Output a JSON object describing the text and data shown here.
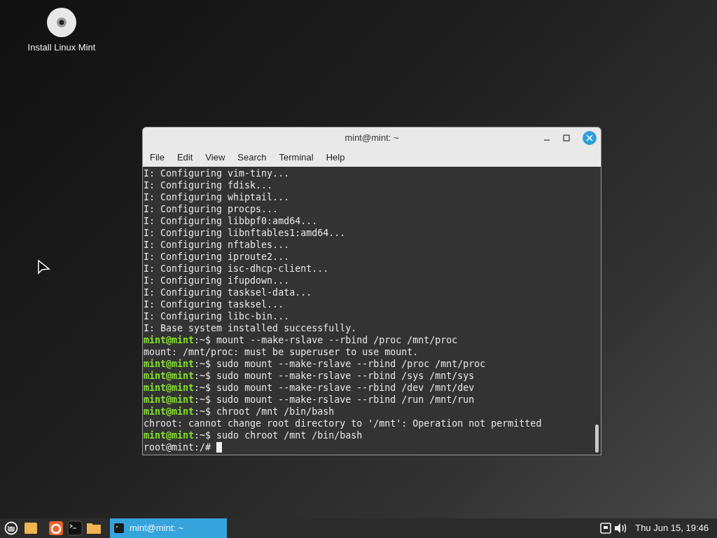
{
  "desktop_icons": [
    {
      "label": "Install Linux Mint"
    }
  ],
  "window": {
    "title": "mint@mint: ~",
    "menu": [
      "File",
      "Edit",
      "View",
      "Search",
      "Terminal",
      "Help"
    ],
    "lines": [
      {
        "kind": "output",
        "text": "I: Configuring vim-tiny..."
      },
      {
        "kind": "output",
        "text": "I: Configuring fdisk..."
      },
      {
        "kind": "output",
        "text": "I: Configuring whiptail..."
      },
      {
        "kind": "output",
        "text": "I: Configuring procps..."
      },
      {
        "kind": "output",
        "text": "I: Configuring libbpf0:amd64..."
      },
      {
        "kind": "output",
        "text": "I: Configuring libnftables1:amd64..."
      },
      {
        "kind": "output",
        "text": "I: Configuring nftables..."
      },
      {
        "kind": "output",
        "text": "I: Configuring iproute2..."
      },
      {
        "kind": "output",
        "text": "I: Configuring isc-dhcp-client..."
      },
      {
        "kind": "output",
        "text": "I: Configuring ifupdown..."
      },
      {
        "kind": "output",
        "text": "I: Configuring tasksel-data..."
      },
      {
        "kind": "output",
        "text": "I: Configuring tasksel..."
      },
      {
        "kind": "output",
        "text": "I: Configuring libc-bin..."
      },
      {
        "kind": "output",
        "text": "I: Base system installed successfully."
      },
      {
        "kind": "prompt",
        "user": "mint@mint",
        "path": ":~$",
        "text": "mount --make-rslave --rbind /proc /mnt/proc"
      },
      {
        "kind": "output",
        "text": "mount: /mnt/proc: must be superuser to use mount."
      },
      {
        "kind": "prompt",
        "user": "mint@mint",
        "path": ":~$",
        "text": "sudo mount --make-rslave --rbind /proc /mnt/proc"
      },
      {
        "kind": "prompt",
        "user": "mint@mint",
        "path": ":~$",
        "text": "sudo mount --make-rslave --rbind /sys /mnt/sys"
      },
      {
        "kind": "prompt",
        "user": "mint@mint",
        "path": ":~$",
        "text": "sudo mount --make-rslave --rbind /dev /mnt/dev"
      },
      {
        "kind": "prompt",
        "user": "mint@mint",
        "path": ":~$",
        "text": "sudo mount --make-rslave --rbind /run /mnt/run"
      },
      {
        "kind": "prompt",
        "user": "mint@mint",
        "path": ":~$",
        "text": "chroot /mnt /bin/bash"
      },
      {
        "kind": "output",
        "text": "chroot: cannot change root directory to '/mnt': Operation not permitted"
      },
      {
        "kind": "prompt",
        "user": "mint@mint",
        "path": ":~$",
        "text": "sudo chroot /mnt /bin/bash"
      },
      {
        "kind": "root",
        "text": "root@mint:/#"
      }
    ]
  },
  "taskbar": {
    "window_buttons": [
      {
        "label": "mint@mint: ~",
        "selected": true
      }
    ],
    "clock": "Thu Jun 15, 19:46"
  }
}
